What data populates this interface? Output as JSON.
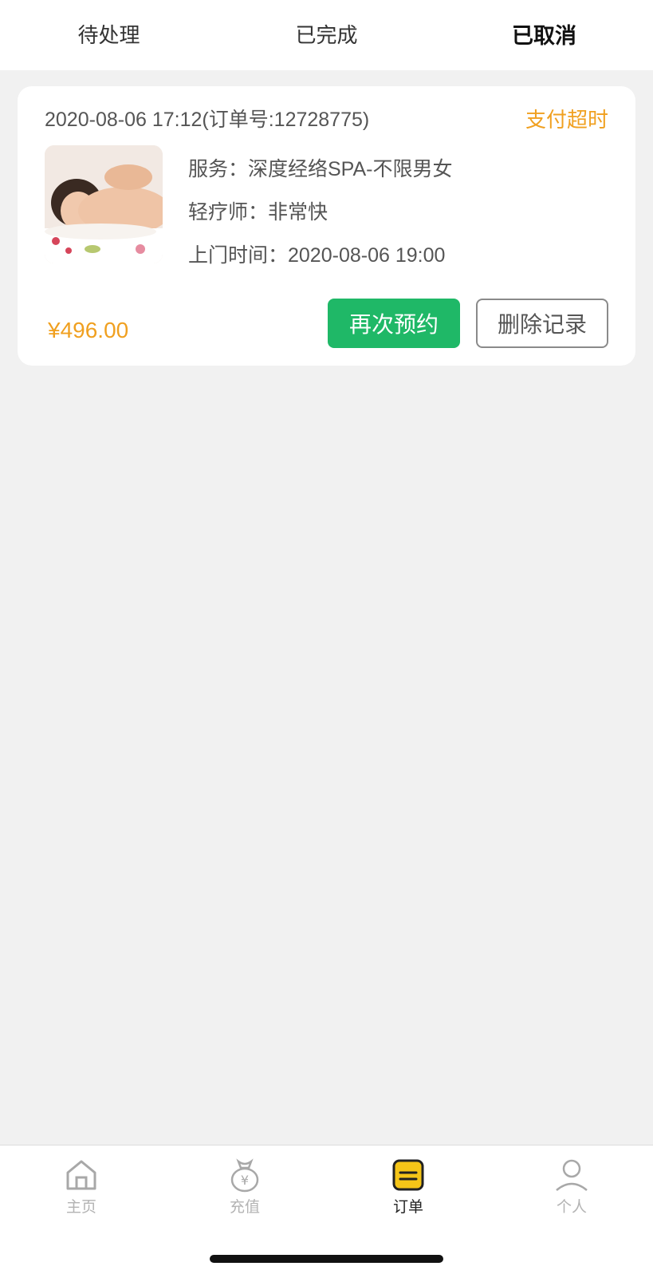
{
  "tabs": [
    {
      "label": "待处理"
    },
    {
      "label": "已完成"
    },
    {
      "label": "已取消"
    }
  ],
  "active_tab": "已取消",
  "order": {
    "time_and_number": "2020-08-06 17:12(订单号:12728775)",
    "status": "支付超时",
    "service": "服务：深度经络SPA-不限男女",
    "therapist": "轻疗师：非常快",
    "visit_time": "上门时间：2020-08-06 19:00",
    "price": "¥496.00",
    "rebook_label": "再次预约",
    "delete_label": "删除记录"
  },
  "bottom_nav": [
    {
      "label": "主页",
      "icon": "home-icon"
    },
    {
      "label": "充值",
      "icon": "money-bag-icon"
    },
    {
      "label": "订单",
      "icon": "order-list-icon"
    },
    {
      "label": "个人",
      "icon": "user-icon"
    }
  ],
  "active_nav": "订单",
  "colors": {
    "accent_orange": "#f0a020",
    "button_green": "#1fb867",
    "nav_active_yellow": "#f5c518"
  }
}
